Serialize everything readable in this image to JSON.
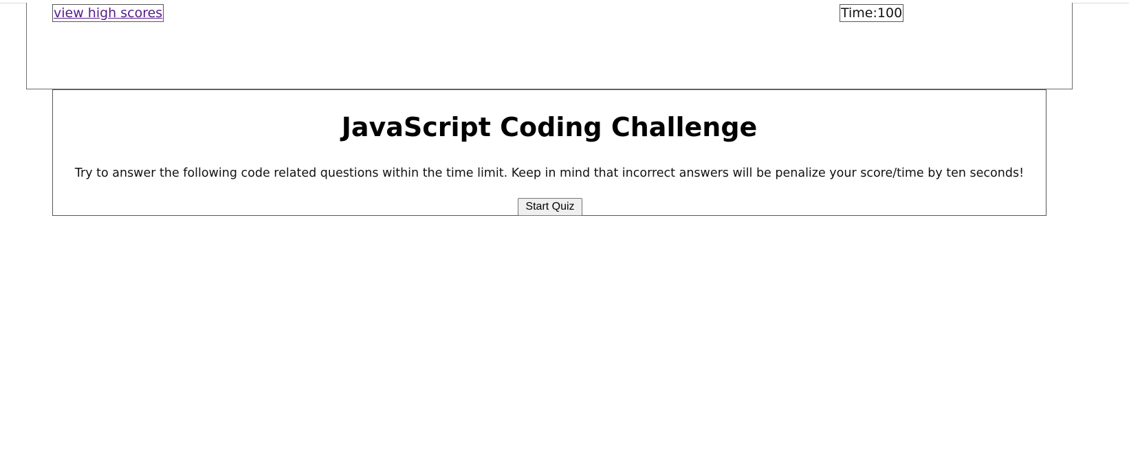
{
  "header": {
    "high_scores_link": "view high scores",
    "timer_label": "Time:",
    "timer_value": "100"
  },
  "intro": {
    "title": "JavaScript Coding Challenge",
    "description": "Try to answer the following code related questions within the time limit. Keep in mind that incorrect answers will be penalize your score/time by ten seconds!",
    "start_button": "Start Quiz"
  },
  "colors": {
    "link": "#551a8b",
    "border": "#555555",
    "button_bg": "#efefef"
  }
}
